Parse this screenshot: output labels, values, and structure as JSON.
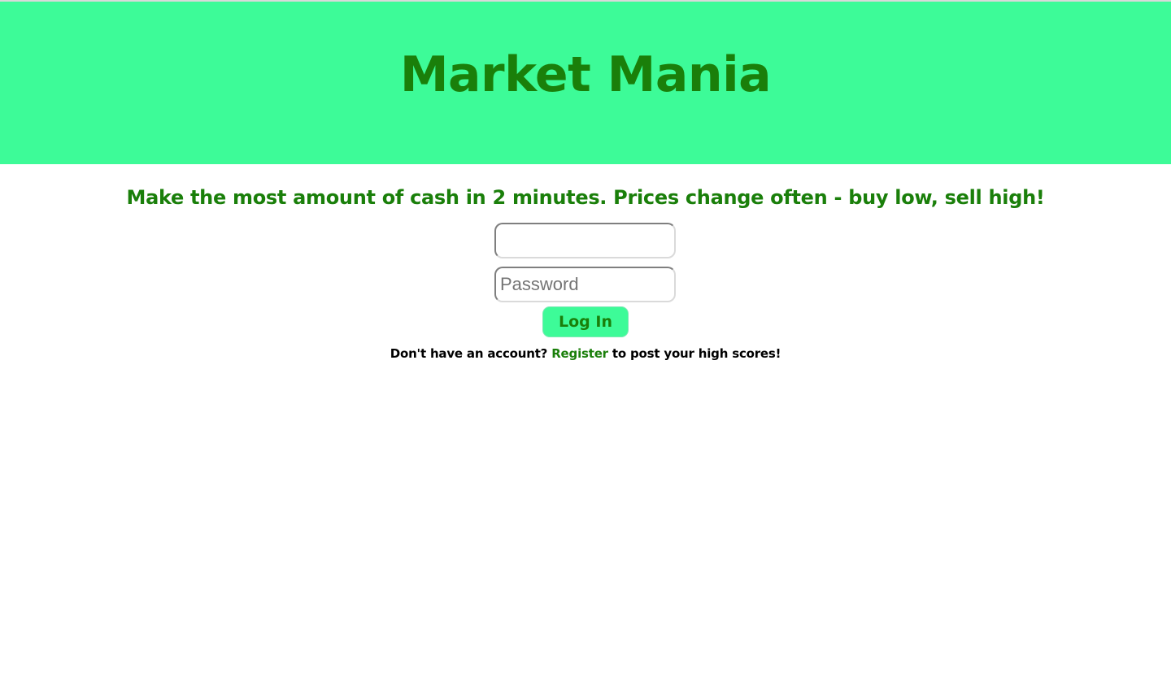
{
  "header": {
    "title": "Market Mania"
  },
  "main": {
    "tagline": "Make the most amount of cash in 2 minutes. Prices change often - buy low, sell high!",
    "username_field": {
      "value": "",
      "placeholder": ""
    },
    "password_field": {
      "value": "",
      "placeholder": "Password"
    },
    "login_button_label": "Log In",
    "register_prompt": {
      "before": "Don't have an account? ",
      "link_label": "Register",
      "after": " to post your high scores!"
    }
  },
  "colors": {
    "header_background": "#3dfb98",
    "brand_green": "#1a7f0a",
    "page_background": "#ffffff"
  }
}
